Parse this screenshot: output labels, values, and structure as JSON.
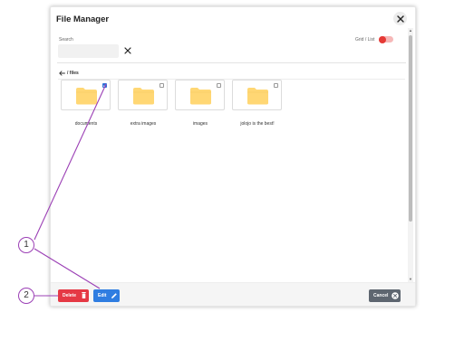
{
  "window": {
    "title": "File Manager"
  },
  "search": {
    "label": "Search",
    "value": "",
    "placeholder": ""
  },
  "view_toggle": {
    "label": "Grid / List",
    "state": "grid"
  },
  "breadcrumb": {
    "path": "/ files"
  },
  "files": [
    {
      "name": "documents",
      "checked": true,
      "icon": "folder-icon"
    },
    {
      "name": "extra images",
      "checked": false,
      "icon": "folder-icon"
    },
    {
      "name": "images",
      "checked": false,
      "icon": "folder-icon"
    },
    {
      "name": "jolojo is the best!",
      "checked": false,
      "icon": "folder-icon"
    }
  ],
  "footer": {
    "delete_label": "Delete",
    "edit_label": "Edit",
    "cancel_label": "Cancel"
  },
  "annotations": [
    {
      "label": "1"
    },
    {
      "label": "2"
    }
  ],
  "colors": {
    "delete": "#e53945",
    "edit": "#2f7de1",
    "cancel": "#5e6670",
    "toggle": "#e53935",
    "checkbox": "#2f6fd6",
    "folder": "#ffd774",
    "annotation": "#9b3fb5"
  }
}
